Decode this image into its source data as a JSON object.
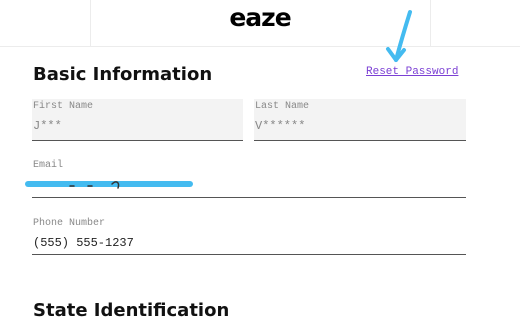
{
  "header": {
    "logo_text": "eaze"
  },
  "basic_info": {
    "title": "Basic Information",
    "reset_password": "Reset Password",
    "first_name": {
      "label": "First Name",
      "value": "J***"
    },
    "last_name": {
      "label": "Last Name",
      "value": "V******"
    },
    "email": {
      "label": "Email",
      "value": ""
    },
    "phone": {
      "label": "Phone Number",
      "value": "(555) 555-1237"
    }
  },
  "state_id": {
    "title": "State Identification"
  },
  "colors": {
    "link": "#7b3fd4",
    "annotation": "#44bbf0"
  },
  "icons": {
    "pointer": "arrow-pointer-icon"
  }
}
